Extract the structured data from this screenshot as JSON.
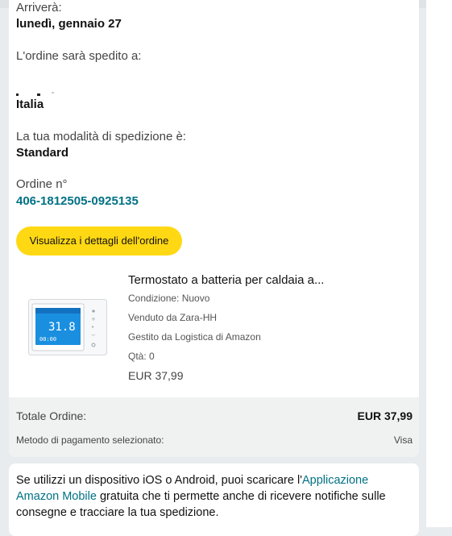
{
  "shipping": {
    "arrival_label": "Arriverà:",
    "arrival_date": "lunedì, gennaio 27",
    "ship_to_label": "L'ordine sarà spedito a:",
    "country": "Italia",
    "method_label": "La tua modalità di spedizione è:",
    "method_value": "Standard",
    "order_label": "Ordine n°",
    "order_number": "406-1812505-0925135"
  },
  "actions": {
    "details_button": "Visualizza i dettagli dell'ordine"
  },
  "product": {
    "title": "Termostato a batteria per caldaia a...",
    "condition": "Condizione: Nuovo",
    "seller": "Venduto da Zara-HH",
    "fulfilled": "Gestito da Logistica di Amazon",
    "quantity": "Qtà: 0",
    "price": "EUR 37,99",
    "image_icon": "thermostat-product-image"
  },
  "totals": {
    "total_label": "Totale Ordine:",
    "total_value": "EUR 37,99",
    "payment_label": "Metodo di pagamento selezionato:",
    "payment_value": "Visa"
  },
  "app_promo": {
    "text_before": "Se utilizzi un dispositivo iOS o Android, puoi scaricare l'",
    "link_text": "Applicazione Amazon Mobile",
    "text_after": " gratuita che ti permette anche di ricevere notifiche sulle consegne e tracciare la tua spedizione."
  },
  "colors": {
    "button_bg": "#ffd814",
    "link": "#007185",
    "totals_bg": "#f0f2f2",
    "page_bg": "#e9ecef"
  }
}
